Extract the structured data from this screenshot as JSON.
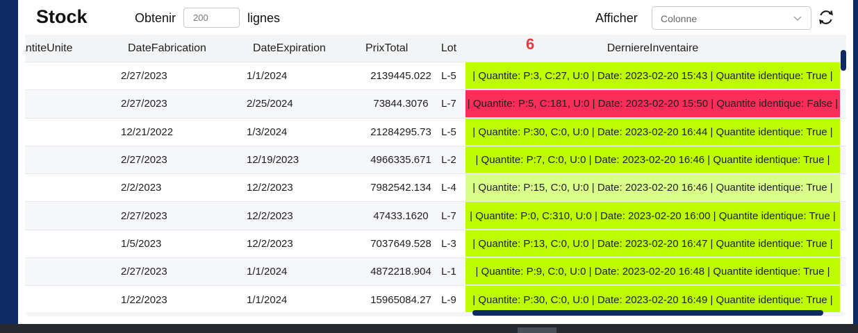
{
  "app": {
    "title": "Stock",
    "obtenir_label": "Obtenir",
    "rows_value": "200",
    "lignes_label": "lignes",
    "afficher_label": "Afficher",
    "column_select_placeholder": "Colonne",
    "badge_count": "6"
  },
  "colors": {
    "ok": "#bdfd00",
    "ok_light": "#d9ff8a",
    "mismatch": "#fc2d59",
    "scrollbar": "#0e2a63"
  },
  "columns": [
    "antiteUnite",
    "DateFabrication",
    "DateExpiration",
    "PrixTotal",
    "Lot",
    "DerniereInventaire"
  ],
  "rows": [
    {
      "qty": "",
      "fab": "2/27/2023",
      "exp": "1/1/2024",
      "prix": "2139445.022",
      "lot": "L-5",
      "inv": "| Quantite: P:3, C:27, U:0 | Date: 2023-02-20 15:43 | Quantite identique: True |",
      "status": "ok"
    },
    {
      "qty": "",
      "fab": "2/27/2023",
      "exp": "2/25/2024",
      "prix": "73844.3076",
      "lot": "L-7",
      "inv": "| Quantite: P:5, C:181, U:0 | Date: 2023-02-20 15:50 | Quantite identique: False |",
      "status": "mismatch"
    },
    {
      "qty": "",
      "fab": "12/21/2022",
      "exp": "1/3/2024",
      "prix": "21284295.73",
      "lot": "L-5",
      "inv": "| Quantite: P:30, C:0, U:0 | Date: 2023-02-20 16:44 | Quantite identique: True |",
      "status": "ok"
    },
    {
      "qty": "",
      "fab": "2/27/2023",
      "exp": "12/19/2023",
      "prix": "4966335.671",
      "lot": "L-2",
      "inv": "| Quantite: P:7, C:0, U:0 | Date: 2023-02-20 16:46 | Quantite identique: True |",
      "status": "ok"
    },
    {
      "qty": "",
      "fab": "2/2/2023",
      "exp": "12/2/2023",
      "prix": "7982542.134",
      "lot": "L-4",
      "inv": "| Quantite: P:15, C:0, U:0 | Date: 2023-02-20 16:46 | Quantite identique: True |",
      "status": "ok_light"
    },
    {
      "qty": "",
      "fab": "2/27/2023",
      "exp": "12/2/2023",
      "prix": "47433.1620",
      "lot": "L-7",
      "inv": "| Quantite: P:0, C:310, U:0 | Date: 2023-02-20 16:00 | Quantite identique: True |",
      "status": "ok"
    },
    {
      "qty": "",
      "fab": "1/5/2023",
      "exp": "12/2/2023",
      "prix": "7037649.528",
      "lot": "L-3",
      "inv": "| Quantite: P:13, C:0, U:0 | Date: 2023-02-20 16:47 | Quantite identique: True |",
      "status": "ok"
    },
    {
      "qty": "",
      "fab": "2/27/2023",
      "exp": "1/1/2024",
      "prix": "4872218.904",
      "lot": "L-1",
      "inv": "| Quantite: P:9, C:0, U:0 | Date: 2023-02-20 16:48 | Quantite identique: True |",
      "status": "ok"
    },
    {
      "qty": "",
      "fab": "1/22/2023",
      "exp": "1/1/2024",
      "prix": "15965084.27",
      "lot": "L-9",
      "inv": "| Quantite: P:30, C:0, U:0 | Date: 2023-02-20 16:49 | Quantite identique: True |",
      "status": "ok"
    }
  ]
}
